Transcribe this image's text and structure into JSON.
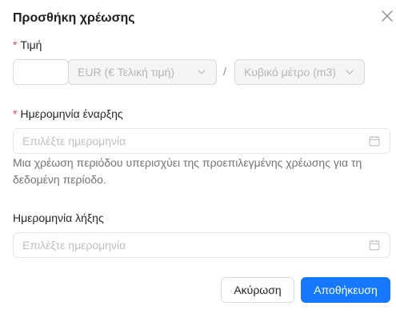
{
  "dialog": {
    "title": "Προσθήκη χρέωσης",
    "close_icon": "close-icon"
  },
  "price": {
    "required_mark": "*",
    "label": "Τιμή",
    "value": "",
    "currency": {
      "selected": "EUR (€ Τελική τιμή)",
      "icon": "chevron-down-icon"
    },
    "separator": "/",
    "unit": {
      "selected": "Κυβικό μέτρο (m3)",
      "icon": "chevron-down-icon"
    }
  },
  "start_date": {
    "required_mark": "*",
    "label": "Ημερομηνία έναρξης",
    "placeholder": "Επιλέξτε ημερομηνία",
    "icon": "calendar-icon",
    "help": "Μια χρέωση περιόδου υπερισχύει της προεπιλεγμένης χρέωσης για τη δεδομένη περίοδο."
  },
  "end_date": {
    "label": "Ημερομηνία λήξης",
    "placeholder": "Επιλέξτε ημερομηνία",
    "icon": "calendar-icon"
  },
  "footer": {
    "cancel_label": "Ακύρωση",
    "save_label": "Αποθήκευση"
  },
  "colors": {
    "primary": "#1677ff",
    "required": "#e5484d",
    "border": "#d9d9d9",
    "disabled_bg": "#f5f5f5"
  }
}
